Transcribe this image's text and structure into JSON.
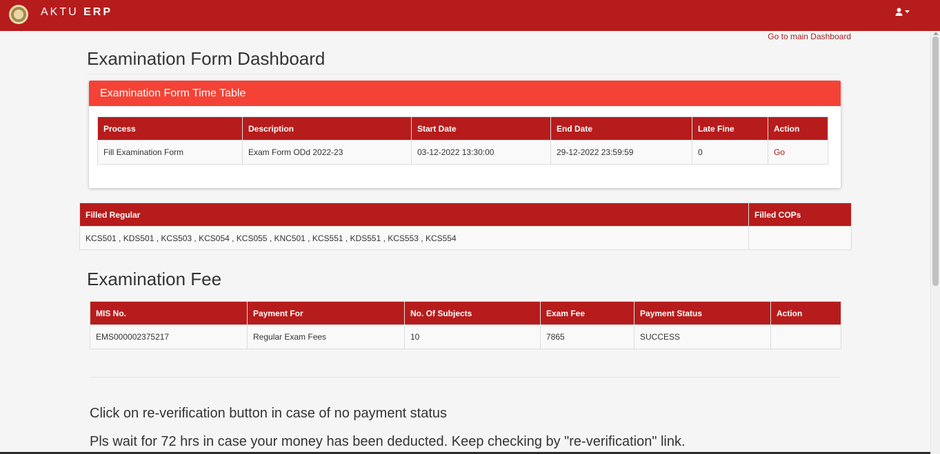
{
  "header": {
    "brand_light": "AKTU",
    "brand_bold": "ERP",
    "logo_icon": "university-seal-icon",
    "user_icon": "user-dropdown-icon",
    "bar_color": "#b71c1c"
  },
  "nav": {
    "main_dashboard_link": "Go to main Dashboard"
  },
  "page_title": "Examination Form Dashboard",
  "timetable": {
    "panel_title": "Examination Form Time Table",
    "headers": [
      "Process",
      "Description",
      "Start Date",
      "End Date",
      "Late Fine",
      "Action"
    ],
    "row": {
      "process": "Fill Examination Form",
      "description": "Exam Form ODd 2022-23",
      "start_date": "03-12-2022 13:30:00",
      "end_date": "29-12-2022 23:59:59",
      "late_fine": "0",
      "action": "Go"
    }
  },
  "filled": {
    "headers": [
      "Filled Regular",
      "Filled COPs"
    ],
    "regular": "KCS501 , KDS501 , KCS503 , KCS054 , KCS055 , KNC501 , KCS551 , KDS551 , KCS553 , KCS554",
    "cops": ""
  },
  "fee": {
    "title": "Examination Fee",
    "headers": [
      "MIS No.",
      "Payment For",
      "No. Of Subjects",
      "Exam Fee",
      "Payment Status",
      "Action"
    ],
    "row": {
      "mis_no": "EMS000002375217",
      "payment_for": "Regular Exam Fees",
      "subjects": "10",
      "exam_fee": "7865",
      "status": "SUCCESS",
      "action": ""
    }
  },
  "notes": {
    "line1": "Click on re-verification button in case of no payment status",
    "line2": "Pls wait for 72 hrs in case your money has been deducted. Keep checking by \"re-verification\" link."
  },
  "colors": {
    "panel_header": "#f44336",
    "table_header": "#b71c1c",
    "link": "#a01f1f"
  }
}
